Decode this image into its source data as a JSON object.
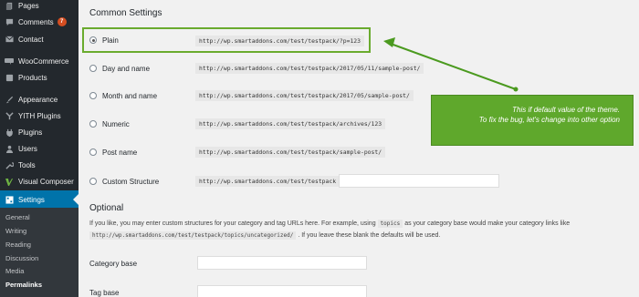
{
  "sidebar": {
    "items": [
      {
        "label": "Pages",
        "icon": "pages-icon"
      },
      {
        "label": "Comments",
        "icon": "comments-icon",
        "badge": "7"
      },
      {
        "label": "Contact",
        "icon": "mail-icon"
      },
      {
        "label": "WooCommerce",
        "icon": "woocommerce-icon"
      },
      {
        "label": "Products",
        "icon": "products-icon"
      },
      {
        "label": "Appearance",
        "icon": "appearance-icon"
      },
      {
        "label": "YITH Plugins",
        "icon": "yith-icon"
      },
      {
        "label": "Plugins",
        "icon": "plugins-icon"
      },
      {
        "label": "Users",
        "icon": "users-icon"
      },
      {
        "label": "Tools",
        "icon": "tools-icon"
      },
      {
        "label": "Visual Composer",
        "icon": "visual-composer-icon"
      },
      {
        "label": "Settings",
        "icon": "settings-icon"
      }
    ],
    "submenu": [
      "General",
      "Writing",
      "Reading",
      "Discussion",
      "Media",
      "Permalinks"
    ],
    "accent_color": "#0073aa"
  },
  "common": {
    "heading": "Common Settings",
    "options": [
      {
        "label": "Plain",
        "code": "http://wp.smartaddons.com/test/testpack/?p=123",
        "checked": true
      },
      {
        "label": "Day and name",
        "code": "http://wp.smartaddons.com/test/testpack/2017/05/11/sample-post/"
      },
      {
        "label": "Month and name",
        "code": "http://wp.smartaddons.com/test/testpack/2017/05/sample-post/"
      },
      {
        "label": "Numeric",
        "code": "http://wp.smartaddons.com/test/testpack/archives/123"
      },
      {
        "label": "Post name",
        "code": "http://wp.smartaddons.com/test/testpack/sample-post/"
      },
      {
        "label": "Custom Structure",
        "code": "http://wp.smartaddons.com/test/testpack"
      }
    ]
  },
  "optional": {
    "heading": "Optional",
    "desc_part1": "If you like, you may enter custom structures for your category and tag URLs here. For example, using",
    "desc_code1": "topics",
    "desc_part2": "as your category base would make your category links like",
    "desc_code2": "http://wp.smartaddons.com/test/testpack/topics/uncategorized/",
    "desc_part3": ". If you leave these blank the defaults will be used.",
    "category_base_label": "Category base",
    "tag_base_label": "Tag base"
  },
  "annotation": {
    "line1": "This if default value of the theme.",
    "line2": "To fix the bug, let's change into other option",
    "color": "#5fa82c"
  }
}
